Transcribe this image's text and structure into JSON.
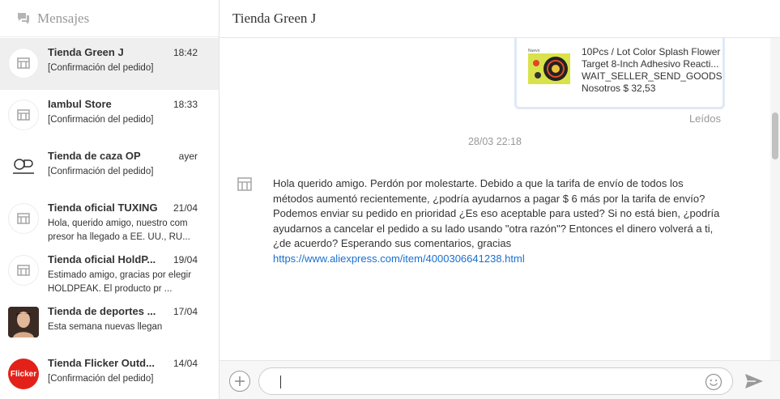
{
  "sidebar": {
    "title": "Mensajes",
    "title_icon": "chat-bubbles-icon",
    "conversations": [
      {
        "name": "Tienda Green J",
        "time": "18:42",
        "preview": "[Confirmación del pedido]",
        "avatar": "store-icon",
        "active": true
      },
      {
        "name": "Iambul Store",
        "time": "18:33",
        "preview": "[Confirmación del pedido]",
        "avatar": "store-icon"
      },
      {
        "name": "Tienda de caza OP",
        "time": "ayer",
        "preview": "[Confirmación del pedido]",
        "avatar": "brand-logo"
      },
      {
        "name": "Tienda oficial TUXING",
        "time": "21/04",
        "preview": "Hola, querido amigo, nuestro com presor ha llegado a EE. UU., RU...",
        "avatar": "store-icon"
      },
      {
        "name": "Tienda oficial HoldP...",
        "time": "19/04",
        "preview": "Estimado amigo, gracias por elegir HOLDPEAK. El producto pr ...",
        "avatar": "store-icon"
      },
      {
        "name": "Tienda de deportes ...",
        "time": "17/04",
        "preview": "Esta semana nuevas llegan",
        "avatar": "person-photo"
      },
      {
        "name": "Tienda Flicker Outd...",
        "time": "14/04",
        "preview": "[Confirmación del pedido]",
        "avatar": "flicker-logo",
        "avatar_text": "Flicker"
      }
    ]
  },
  "chat": {
    "title": "Tienda Green J",
    "product_card": {
      "thumb_label": "Nuevo",
      "title_line1": "10Pcs / Lot Color Splash Flower",
      "title_line2": "Target 8-Inch Adhesivo Reacti...",
      "status": "WAIT_SELLER_SEND_GOODS",
      "price": "Nosotros $ 32,53"
    },
    "read_status": "Leídos",
    "date_separator": "28/03 22:18",
    "message": {
      "avatar": "store-icon",
      "text": "Hola querido amigo. Perdón por molestarte. Debido a que la tarifa de envío de todos los métodos aumentó recientemente, ¿podría ayudarnos a pagar $ 6 más por la tarifa de envío? Podemos enviar su pedido en prioridad ¿Es eso aceptable para usted? Si no está bien, ¿podría ayudarnos a cancelar el pedido a su lado usando \"otra razón\"? Entonces el dinero volverá a ti, ¿de acuerdo? Esperando sus comentarios, gracias",
      "link": "https://www.aliexpress.com/item/4000306641238.html"
    }
  },
  "composer": {
    "value": "",
    "placeholder": "",
    "add_icon": "plus-icon",
    "emoji_icon": "smiley-icon",
    "send_icon": "send-icon"
  },
  "colors": {
    "link": "#1a6fd1",
    "active_row": "#efefef",
    "card_border": "#dfe9f7",
    "flicker_red": "#e32119"
  }
}
